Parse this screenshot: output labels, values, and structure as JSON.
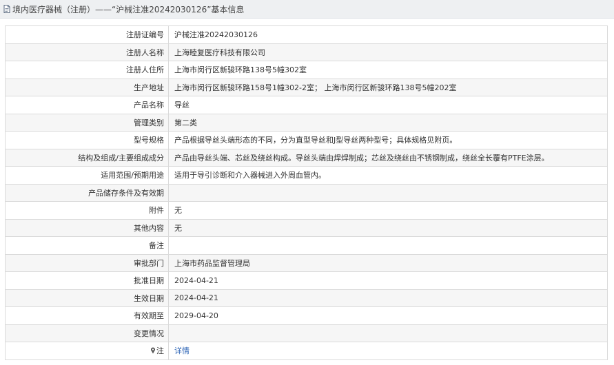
{
  "header": {
    "title": "境内医疗器械（注册）——“沪械注准20242030126”基本信息",
    "icon": "document-icon"
  },
  "rows": [
    {
      "name": "registration-number",
      "label": "注册证编号",
      "value": "沪械注准20242030126"
    },
    {
      "name": "registrant-name",
      "label": "注册人名称",
      "value": "上海睦复医疗科技有限公司"
    },
    {
      "name": "registrant-address",
      "label": "注册人住所",
      "value": "上海市闵行区新骏环路138号5幢302室"
    },
    {
      "name": "production-address",
      "label": "生产地址",
      "value": "上海市闵行区新骏环路158号1幢302-2室； 上海市闵行区新骏环路138号5幢202室"
    },
    {
      "name": "product-name",
      "label": "产品名称",
      "value": "导丝"
    },
    {
      "name": "management-class",
      "label": "管理类别",
      "value": "第二类"
    },
    {
      "name": "model-spec",
      "label": "型号规格",
      "value": "产品根据导丝头端形态的不同，分为直型导丝和J型导丝两种型号；具体规格见附页。"
    },
    {
      "name": "structure-composition",
      "label": "结构及组成/主要组成成分",
      "value": "产品由导丝头端、芯丝及绕丝构成。导丝头端由焊焊制成；芯丝及绕丝由不锈钢制成，绕丝全长覆有PTFE涂层。"
    },
    {
      "name": "intended-use",
      "label": "适用范围/预期用途",
      "value": "适用于导引诊断和介入器械进入外周血管内。"
    },
    {
      "name": "storage-validity",
      "label": "产品储存条件及有效期",
      "value": ""
    },
    {
      "name": "attachment",
      "label": "附件",
      "value": "无"
    },
    {
      "name": "other-content",
      "label": "其他内容",
      "value": "无"
    },
    {
      "name": "remarks",
      "label": "备注",
      "value": ""
    },
    {
      "name": "approval-department",
      "label": "审批部门",
      "value": "上海市药品监督管理局"
    },
    {
      "name": "approval-date",
      "label": "批准日期",
      "value": "2024-04-21"
    },
    {
      "name": "effective-date",
      "label": "生效日期",
      "value": "2024-04-21"
    },
    {
      "name": "valid-until",
      "label": "有效期至",
      "value": "2029-04-20"
    },
    {
      "name": "change-status",
      "label": "变更情况",
      "value": ""
    }
  ],
  "note": {
    "label": "注",
    "icon": "pin-icon",
    "link_text": "详情"
  },
  "colors": {
    "header_bg": "#eef0f2",
    "border": "#dadada",
    "alt_row_bg": "#f6f6f6",
    "link": "#2b63b5"
  }
}
